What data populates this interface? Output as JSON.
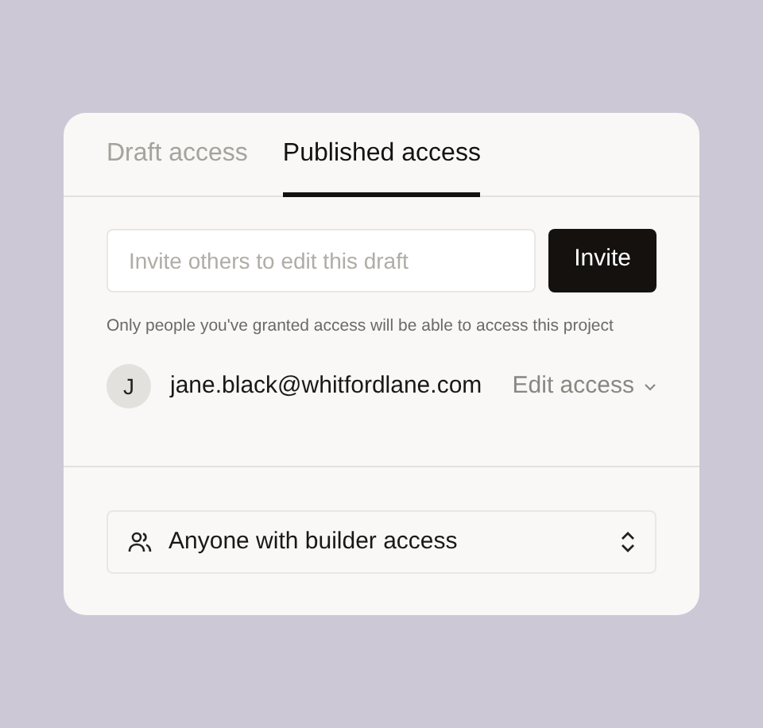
{
  "tabs": [
    {
      "label": "Draft access",
      "selected": false
    },
    {
      "label": "Published access",
      "selected": true
    }
  ],
  "invite": {
    "placeholder": "Invite others to edit this draft",
    "button": "Invite"
  },
  "note": "Only people you've granted access will be able to access this project",
  "members": [
    {
      "initial": "J",
      "email": "jane.black@whitfordlane.com",
      "access": "Edit access"
    }
  ],
  "audience": {
    "value": "Anyone with builder access"
  }
}
